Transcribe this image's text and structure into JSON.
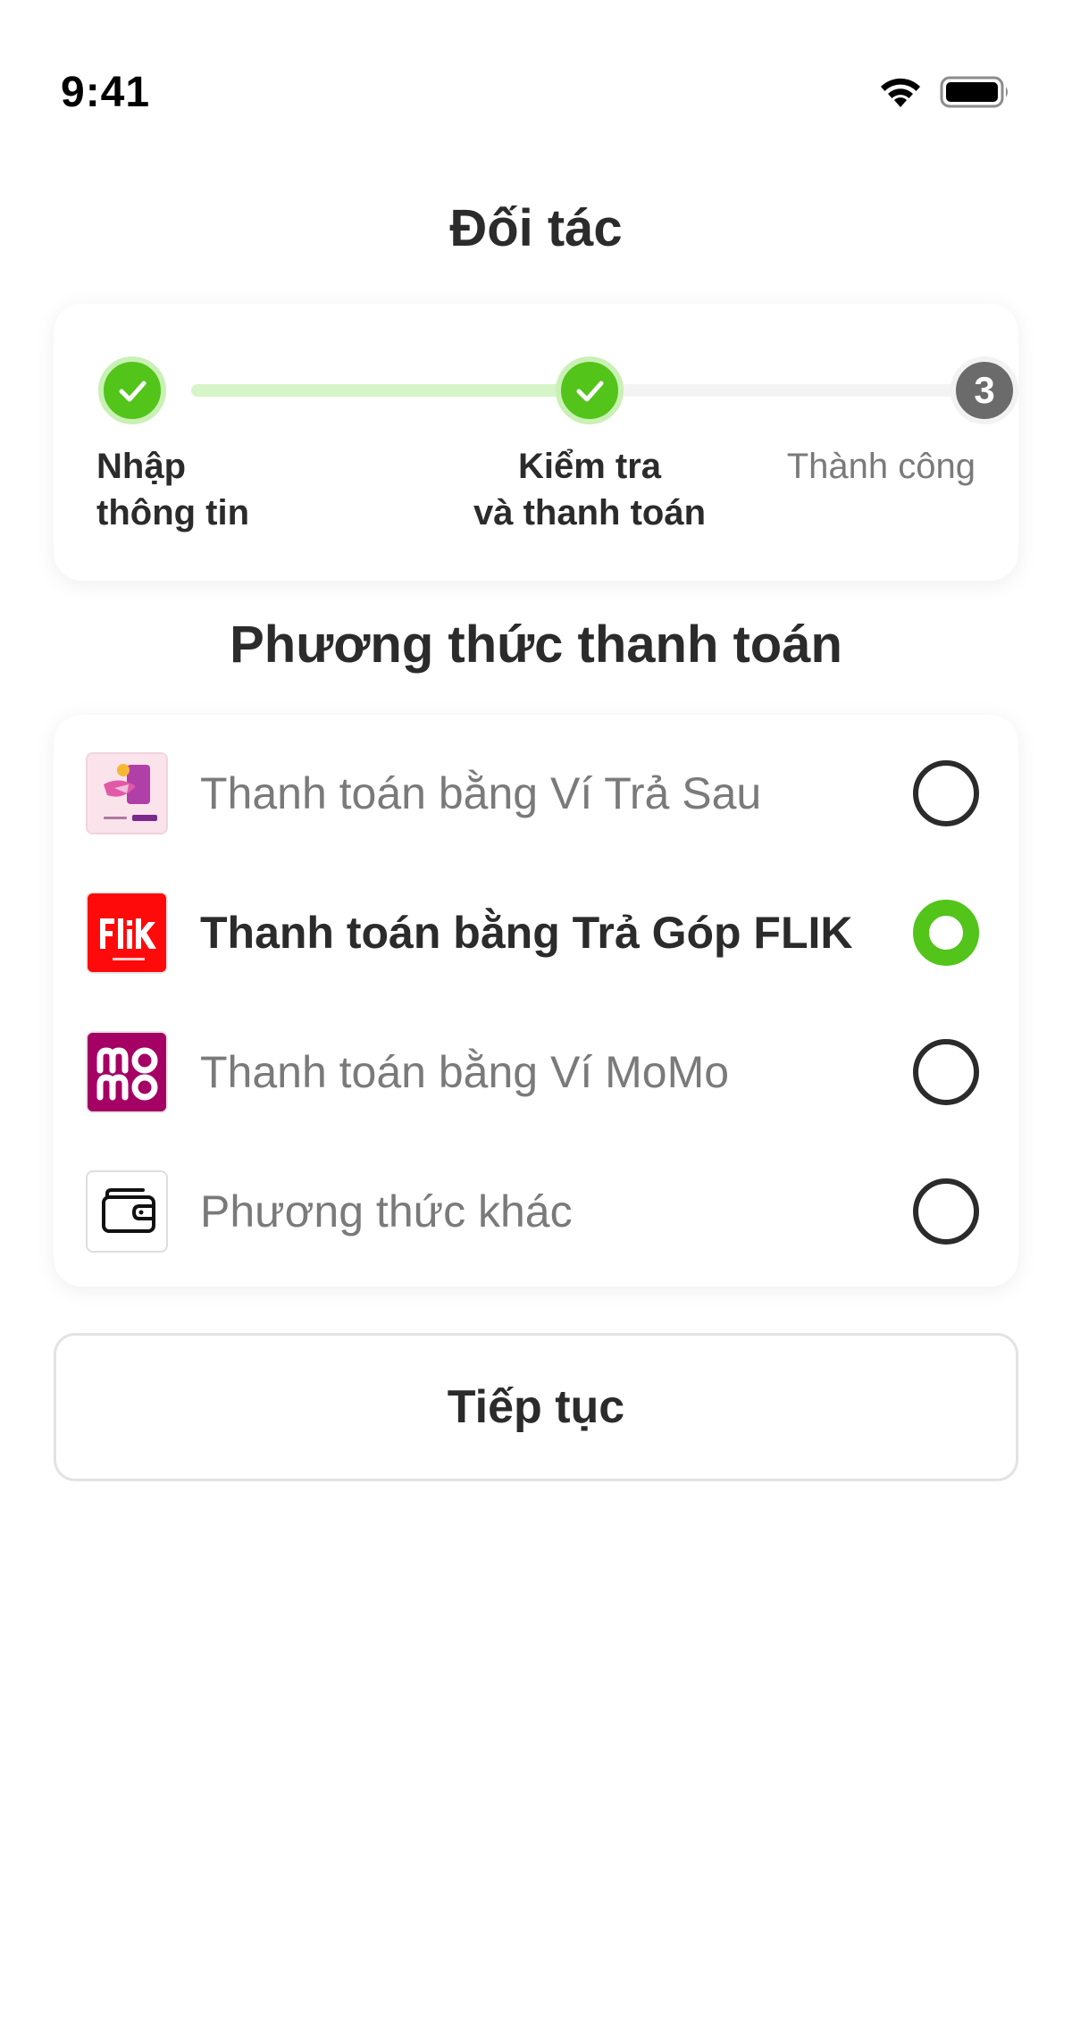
{
  "status_bar": {
    "time": "9:41",
    "icons": [
      "wifi-icon",
      "battery-icon"
    ]
  },
  "header": {
    "title": "Đối tác"
  },
  "stepper": {
    "steps": [
      {
        "line1": "Nhập",
        "line2": "thông tin",
        "state": "done"
      },
      {
        "line1": "Kiểm tra",
        "line2": "và thanh toán",
        "state": "done"
      },
      {
        "number": "3",
        "line1": "Thành công",
        "state": "current"
      }
    ]
  },
  "payment": {
    "section_title": "Phương thức thanh toán",
    "methods": [
      {
        "label": "Thanh toán bằng Ví Trả Sau",
        "selected": false,
        "logo": "tpbank-wallet-logo"
      },
      {
        "label": "Thanh toán bằng Trả Góp FLIK",
        "selected": true,
        "logo": "flik-logo"
      },
      {
        "label": "Thanh toán bằng Ví MoMo",
        "selected": false,
        "logo": "momo-logo"
      },
      {
        "label": "Phương thức khác",
        "selected": false,
        "logo": "wallet-icon"
      }
    ]
  },
  "actions": {
    "continue_label": "Tiếp tục"
  },
  "colors": {
    "accent": "#52c41a",
    "accent_light": "#d6f5c8",
    "text": "#2b2b2b",
    "muted": "#7a7a7a",
    "step_pending": "#6b6b6b",
    "flik_red": "#ff0a0a",
    "momo_magenta": "#a50064"
  }
}
